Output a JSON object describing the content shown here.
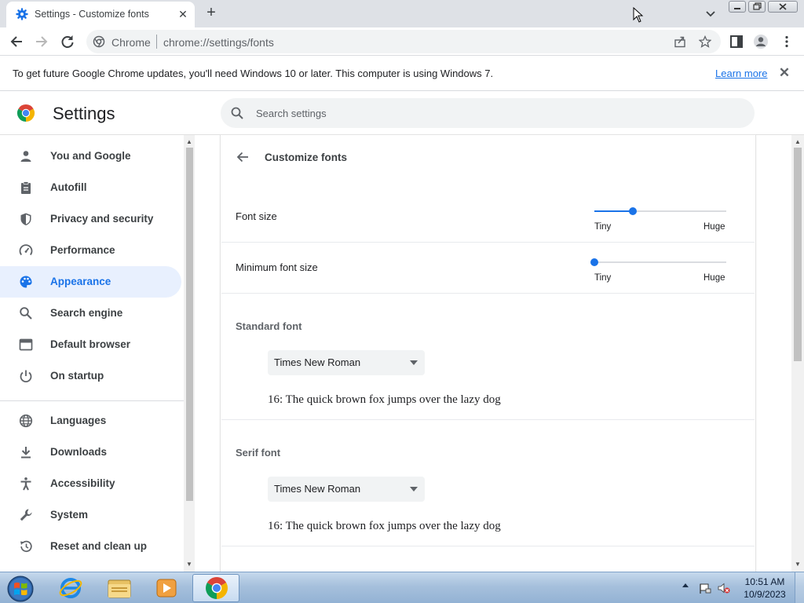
{
  "tab": {
    "title": "Settings - Customize fonts",
    "close": "✕",
    "new_tab": "+"
  },
  "toolbar": {
    "origin": "Chrome",
    "url": "chrome://settings/fonts"
  },
  "infobar": {
    "message": "To get future Google Chrome updates, you'll need Windows 10 or later. This computer is using Windows 7.",
    "link": "Learn more",
    "close": "✕"
  },
  "header": {
    "title": "Settings",
    "search_placeholder": "Search settings"
  },
  "sidebar": {
    "items": [
      {
        "label": "You and Google",
        "icon": "person-icon"
      },
      {
        "label": "Autofill",
        "icon": "clipboard-icon"
      },
      {
        "label": "Privacy and security",
        "icon": "shield-icon"
      },
      {
        "label": "Performance",
        "icon": "speedometer-icon"
      },
      {
        "label": "Appearance",
        "icon": "palette-icon",
        "active": true
      },
      {
        "label": "Search engine",
        "icon": "search-icon"
      },
      {
        "label": "Default browser",
        "icon": "browser-icon"
      },
      {
        "label": "On startup",
        "icon": "power-icon"
      },
      {
        "label": "Languages",
        "icon": "globe-icon"
      },
      {
        "label": "Downloads",
        "icon": "download-icon"
      },
      {
        "label": "Accessibility",
        "icon": "accessibility-icon"
      },
      {
        "label": "System",
        "icon": "wrench-icon"
      },
      {
        "label": "Reset and clean up",
        "icon": "history-icon"
      }
    ]
  },
  "page": {
    "title": "Customize fonts",
    "font_size": {
      "label": "Font size",
      "min": "Tiny",
      "max": "Huge",
      "value_fraction": 0.29
    },
    "min_font_size": {
      "label": "Minimum font size",
      "min": "Tiny",
      "max": "Huge",
      "value_fraction": 0.0
    },
    "standard_font": {
      "label": "Standard font",
      "value": "Times New Roman",
      "sample": "16: The quick brown fox jumps over the lazy dog"
    },
    "serif_font": {
      "label": "Serif font",
      "value": "Times New Roman",
      "sample": "16: The quick brown fox jumps over the lazy dog"
    }
  },
  "taskbar": {
    "time": "10:51 AM",
    "date": "10/9/2023"
  },
  "colors": {
    "accent": "#1a73e8",
    "active_nav_bg": "#e8f0fe"
  }
}
